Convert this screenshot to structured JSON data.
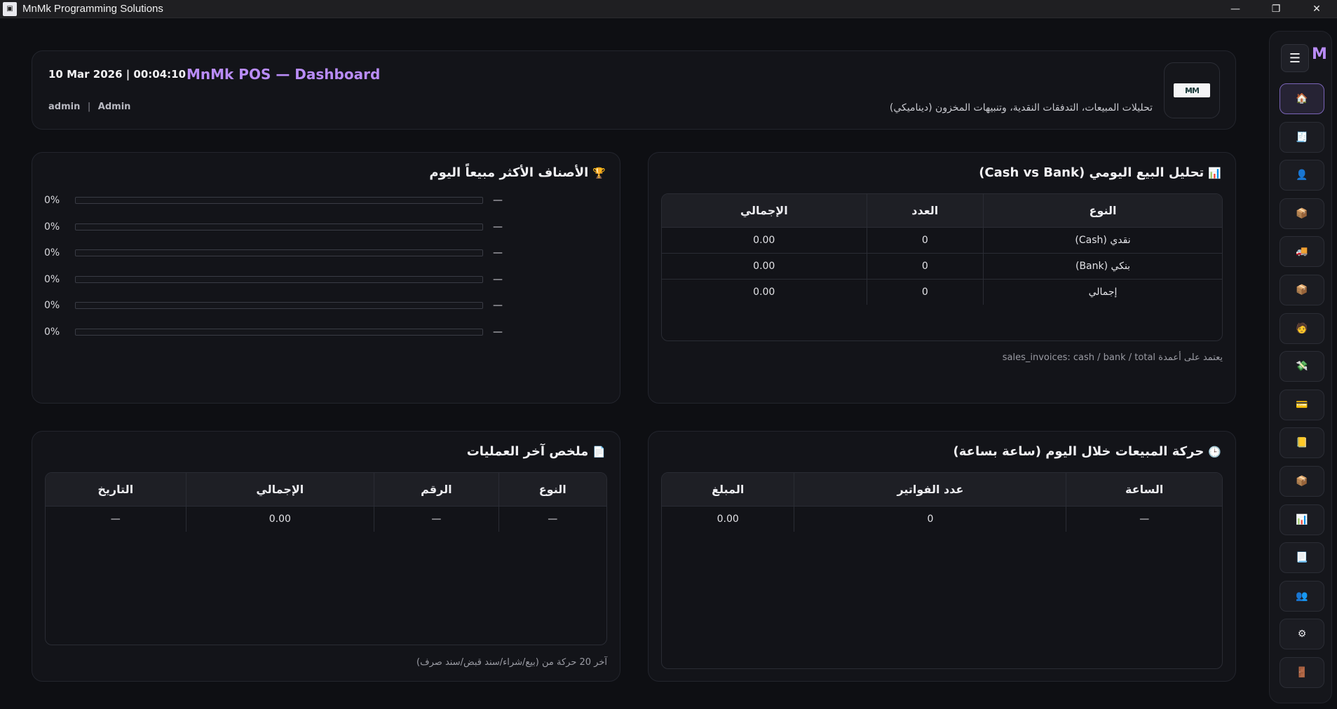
{
  "window": {
    "title": "MnMk Programming Solutions",
    "controls": [
      "—",
      "❐",
      "✕"
    ]
  },
  "header": {
    "datetime": "10 Mar 2026 | 00:04:10",
    "title": "MnMk POS — Dashboard",
    "username": "admin",
    "separator": "|",
    "role": "Admin",
    "subtitle": "تحليلات المبيعات، التدفقات النقدية، وتنبيهات المخزون (ديناميكي)",
    "logo_text": "M̶M"
  },
  "daily_sales": {
    "icon": "📊",
    "title": "تحليل البيع اليومي (Cash vs Bank)",
    "columns": [
      "النوع",
      "العدد",
      "الإجمالي"
    ],
    "rows": [
      [
        "نقدي (Cash)",
        "0",
        "0.00"
      ],
      [
        "بنكي (Bank)",
        "0",
        "0.00"
      ],
      [
        "إجمالي",
        "0",
        "0.00"
      ]
    ],
    "note": "يعتمد على أعمدة sales_invoices: cash / bank / total"
  },
  "top_products": {
    "icon": "🏆",
    "title": "الأصناف الأكثر مبيعاً اليوم",
    "items": [
      {
        "pct": "0%",
        "name": "—",
        "fill": 0
      },
      {
        "pct": "0%",
        "name": "—",
        "fill": 0
      },
      {
        "pct": "0%",
        "name": "—",
        "fill": 0
      },
      {
        "pct": "0%",
        "name": "—",
        "fill": 0
      },
      {
        "pct": "0%",
        "name": "—",
        "fill": 0
      },
      {
        "pct": "0%",
        "name": "—",
        "fill": 0
      }
    ]
  },
  "hourly_sales": {
    "icon": "🕒",
    "title": "حركة المبيعات خلال اليوم (ساعة بساعة)",
    "columns": [
      "الساعة",
      "عدد الفواتير",
      "المبلغ"
    ],
    "rows": [
      [
        "—",
        "0",
        "0.00"
      ]
    ]
  },
  "recent_ops": {
    "icon": "📄",
    "title": "ملخص آخر العمليات",
    "columns": [
      "النوع",
      "الرقم",
      "الإجمالي",
      "التاريخ"
    ],
    "rows": [
      [
        "—",
        "—",
        "0.00",
        "—"
      ]
    ],
    "note": "آخر 20 حركة من (بيع/شراء/سند قبض/سند صرف)"
  },
  "sidebar": {
    "menu_icon": "☰",
    "brand": "M",
    "items": [
      {
        "name": "home-icon",
        "glyph": "🏠",
        "active": true
      },
      {
        "name": "invoice-icon",
        "glyph": "🧾",
        "active": false
      },
      {
        "name": "customer-icon",
        "glyph": "👤",
        "active": false
      },
      {
        "name": "box-icon",
        "glyph": "📦",
        "active": false
      },
      {
        "name": "truck-icon",
        "glyph": "🚚",
        "active": false
      },
      {
        "name": "package-icon",
        "glyph": "📦",
        "active": false
      },
      {
        "name": "employee-icon",
        "glyph": "🧑",
        "active": false
      },
      {
        "name": "money-icon",
        "glyph": "💸",
        "active": false
      },
      {
        "name": "card-icon",
        "glyph": "💳",
        "active": false
      },
      {
        "name": "ledger-icon",
        "glyph": "📒",
        "active": false
      },
      {
        "name": "inventory-icon",
        "glyph": "📦",
        "active": false
      },
      {
        "name": "chart-icon",
        "glyph": "📊",
        "active": false
      },
      {
        "name": "report-icon",
        "glyph": "📃",
        "active": false
      },
      {
        "name": "users-icon",
        "glyph": "👥",
        "active": false
      },
      {
        "name": "settings-icon",
        "glyph": "⚙",
        "active": false
      },
      {
        "name": "logout-icon",
        "glyph": "🚪",
        "active": false
      }
    ]
  }
}
